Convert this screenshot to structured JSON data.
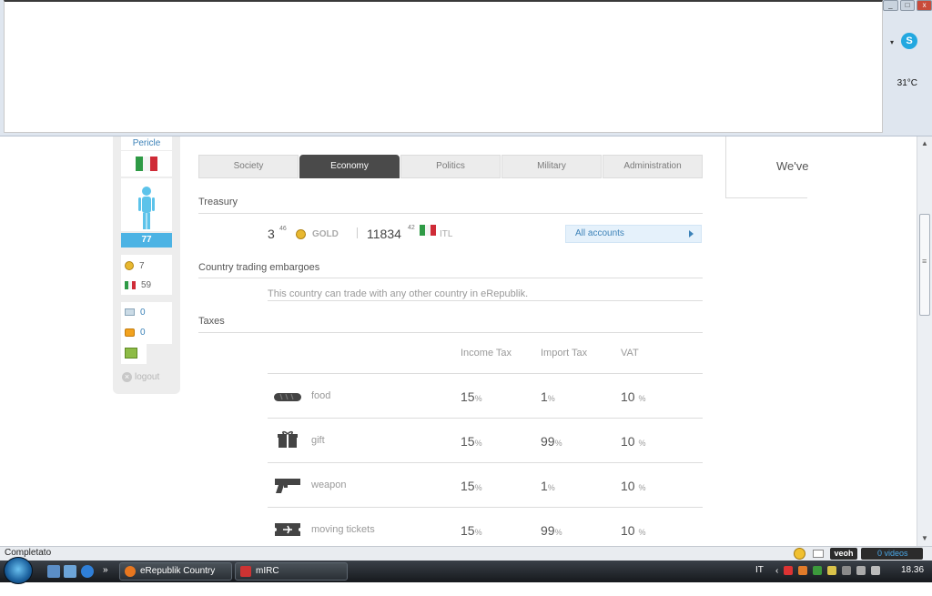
{
  "chrome": {
    "temperature": "31°C",
    "window_buttons": [
      "_",
      "□",
      "x"
    ]
  },
  "sidebar": {
    "name": "Pericle",
    "level": "77",
    "gold": "7",
    "currency": "59",
    "messages": "0",
    "alerts": "0",
    "logout": "logout"
  },
  "tabs": [
    {
      "label": "Society",
      "active": false
    },
    {
      "label": "Economy",
      "active": true
    },
    {
      "label": "Politics",
      "active": false
    },
    {
      "label": "Military",
      "active": false
    },
    {
      "label": "Administration",
      "active": false
    }
  ],
  "treasury": {
    "title": "Treasury",
    "gold_value": "3",
    "gold_decimals": "46",
    "gold_label": "GOLD",
    "itl_value": "11834",
    "itl_decimals": "42",
    "itl_label": "ITL",
    "all_accounts": "All accounts"
  },
  "embargoes": {
    "title": "Country trading embargoes",
    "text": "This country can trade with any other country in eRepublik."
  },
  "taxes": {
    "title": "Taxes",
    "headers": {
      "income": "Income Tax",
      "import": "Import Tax",
      "vat": "VAT"
    },
    "rows": [
      {
        "icon": "bread-icon",
        "name": "food",
        "income": "15",
        "import": "1",
        "vat": "10 "
      },
      {
        "icon": "gift-icon",
        "name": "gift",
        "income": "15",
        "import": "99",
        "vat": "10 "
      },
      {
        "icon": "gun-icon",
        "name": "weapon",
        "income": "15",
        "import": "1",
        "vat": "10 "
      },
      {
        "icon": "ticket-icon",
        "name": "moving tickets",
        "income": "15",
        "import": "99",
        "vat": "10 "
      }
    ],
    "percent": "%"
  },
  "right_panel": {
    "text": "We've"
  },
  "statusbar": {
    "text": "Completato",
    "veoh": "veoh",
    "videos": "0 videos"
  },
  "taskbar": {
    "tasks": [
      "eRepublik Country E...",
      "mIRC"
    ],
    "language": "IT",
    "clock": "18.36"
  }
}
